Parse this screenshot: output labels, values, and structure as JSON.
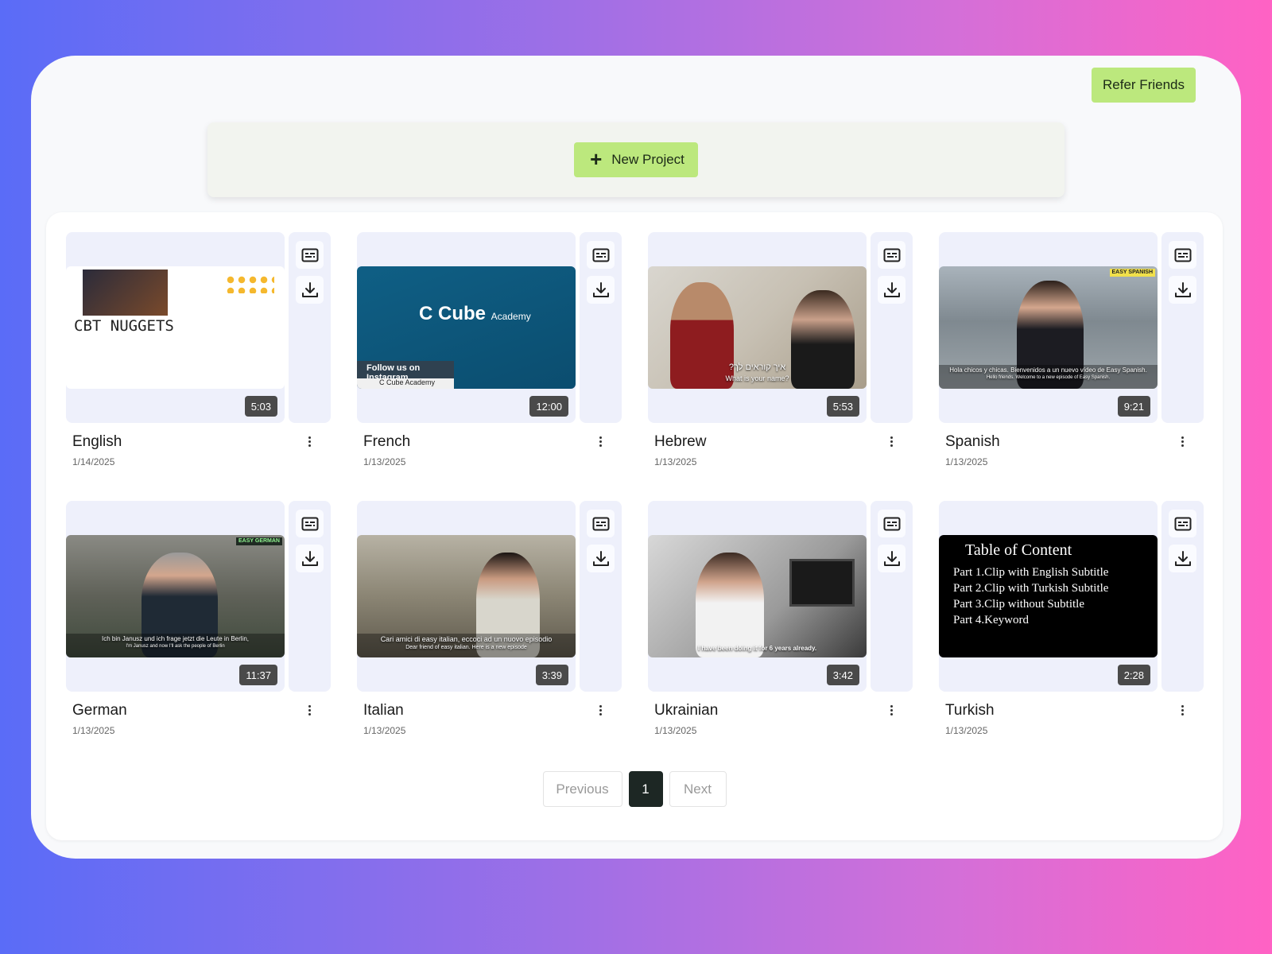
{
  "header": {
    "refer_label": "Refer Friends"
  },
  "toolbar": {
    "new_project_label": "New Project"
  },
  "cards": [
    {
      "title": "English",
      "date": "1/14/2025",
      "duration": "5:03",
      "thumb_text": "CBT NUGGETS"
    },
    {
      "title": "French",
      "date": "1/13/2025",
      "duration": "12:00",
      "thumb_brand": "C Cube",
      "thumb_brand_sub": "Academy",
      "thumb_follow": "Follow us on Instagram",
      "thumb_handle": "C Cube Academy"
    },
    {
      "title": "Hebrew",
      "date": "1/13/2025",
      "duration": "5:53",
      "sub1": "?איך קוראים לך",
      "sub2": "What is your name?"
    },
    {
      "title": "Spanish",
      "date": "1/13/2025",
      "duration": "9:21",
      "sub1": "Hola chicos y chicas. Bienvenidos a un nuevo vídeo de Easy Spanish.",
      "sub2": "Hello friends. Welcome to a new episode of Easy Spanish.",
      "badge": "EASY SPANISH"
    },
    {
      "title": "German",
      "date": "1/13/2025",
      "duration": "11:37",
      "sub1": "Ich bin Janusz und ich frage jetzt die Leute in Berlin,",
      "sub2": "I'm Janusz and now I'll ask the people of Berlin",
      "badge": "EASY GERMAN"
    },
    {
      "title": "Italian",
      "date": "1/13/2025",
      "duration": "3:39",
      "sub1": "Cari amici di easy italian, eccoci ad un nuovo episodio",
      "sub2": "Dear friend of easy italian. Here is a new episode"
    },
    {
      "title": "Ukrainian",
      "date": "1/13/2025",
      "duration": "3:42",
      "sub1": "I have been doing it for 6 years already."
    },
    {
      "title": "Turkish",
      "date": "1/13/2025",
      "duration": "2:28",
      "toc_title": "Table of Content",
      "toc_items": [
        "Part 1.Clip with English Subtitle",
        "Part 2.Clip with Turkish Subtitle",
        "Part 3.Clip without Subtitle",
        "Part 4.Keyword"
      ]
    }
  ],
  "pagination": {
    "previous_label": "Previous",
    "current_page": "1",
    "next_label": "Next"
  },
  "icons": {
    "subtitles": "subtitles-icon",
    "download": "download-icon",
    "more": "kebab-menu-icon",
    "add": "plus-icon"
  },
  "colors": {
    "accent": "#bce87d",
    "active_page": "#1d2724",
    "card_bg": "#eef0fb"
  }
}
